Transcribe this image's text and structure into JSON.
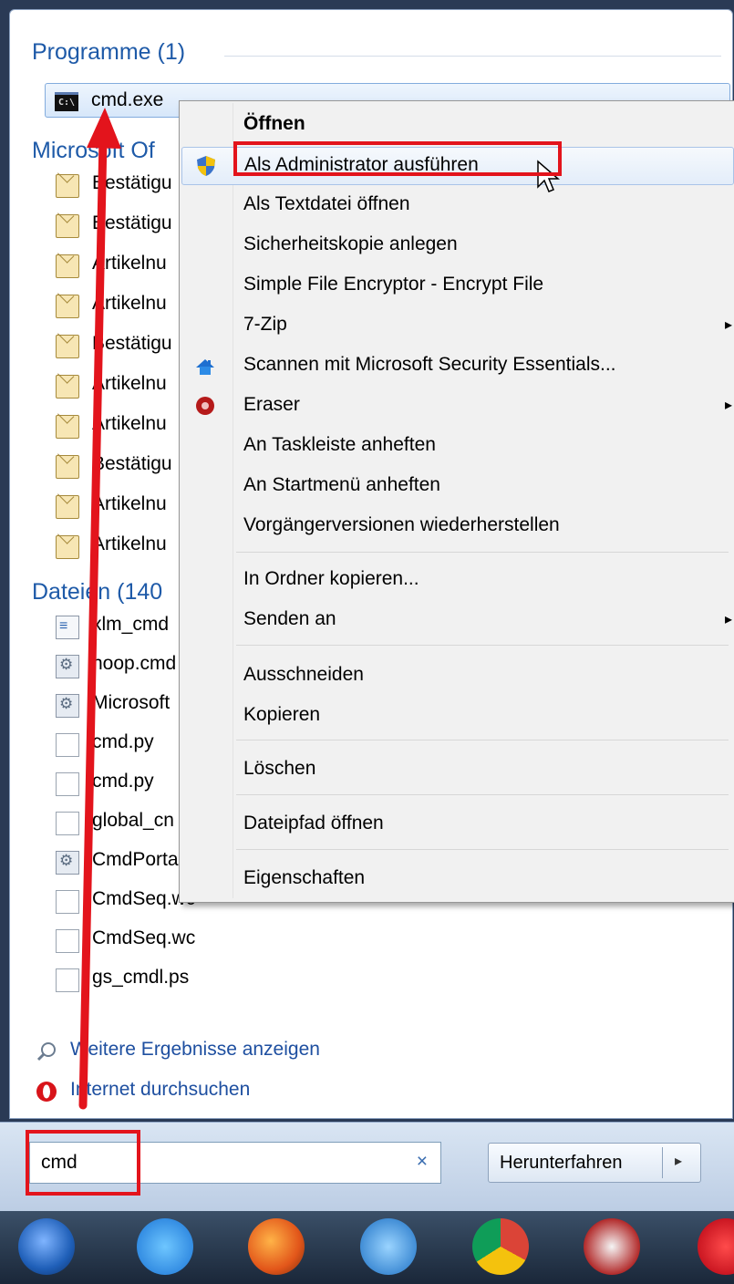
{
  "programs": {
    "title": "Programme (1)",
    "item": "cmd.exe"
  },
  "office": {
    "title": "Microsoft Of",
    "items": [
      "Bestätigu",
      "Bestätigu",
      "Artikelnu",
      "Artikelnu",
      "Bestätigu",
      "Artikelnu",
      "Artikelnu",
      "Bestätigu",
      "Artikelnu",
      "Artikelnu"
    ]
  },
  "files": {
    "title": "Dateien (140",
    "items": [
      "xlm_cmd",
      "hoop.cmd",
      "Microsoft",
      "cmd.py",
      "cmd.py",
      "global_cn",
      "CmdPorta",
      "CmdSeq.wc",
      "CmdSeq.wc",
      "gs_cmdl.ps"
    ]
  },
  "footer": {
    "more_results": "Weitere Ergebnisse anzeigen",
    "internet_search": "Internet durchsuchen"
  },
  "search": {
    "value": "cmd",
    "clear": "×"
  },
  "shutdown": {
    "label": "Herunterfahren",
    "arrow": "▸"
  },
  "context_menu": {
    "open": "Öffnen",
    "run_as_admin": "Als Administrator ausführen",
    "open_as_text": "Als Textdatei öffnen",
    "backup": "Sicherheitskopie anlegen",
    "encrypt": "Simple File Encryptor - Encrypt File",
    "zip": "7-Zip",
    "scan": "Scannen mit Microsoft Security Essentials...",
    "eraser": "Eraser",
    "pin_taskbar": "An Taskleiste anheften",
    "pin_start": "An Startmenü anheften",
    "restore_versions": "Vorgängerversionen wiederherstellen",
    "copy_to_folder": "In Ordner kopieren...",
    "send_to": "Senden an",
    "cut": "Ausschneiden",
    "copy": "Kopieren",
    "delete": "Löschen",
    "open_path": "Dateipfad öffnen",
    "properties": "Eigenschaften",
    "submenu_arrow": "▸"
  },
  "colors": {
    "highlight_box": "#e3141c",
    "arrow": "#e3141c",
    "section_title": "#1e5aa8"
  }
}
